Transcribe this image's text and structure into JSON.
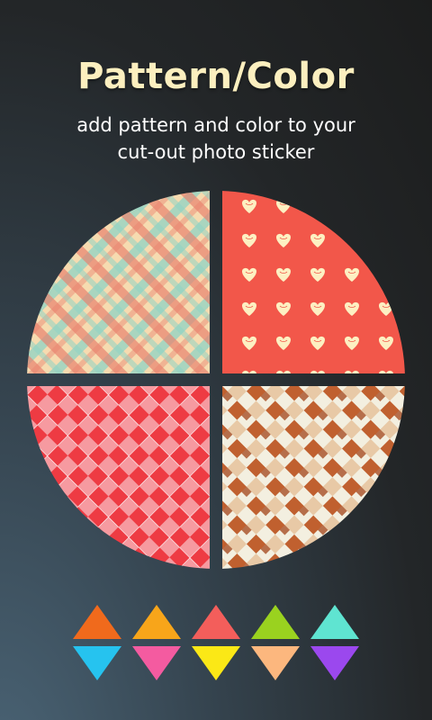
{
  "header": {
    "title": "Pattern/Color",
    "subtitle_line1": "add pattern and color to your",
    "subtitle_line2": "cut-out photo sticker"
  },
  "patterns": [
    {
      "name": "plaid-pattern",
      "colors": [
        "#f7d9a8",
        "#8fd3c4",
        "#e9836f"
      ]
    },
    {
      "name": "hearts-pattern",
      "colors": [
        "#f2574a",
        "#fdf0c2"
      ]
    },
    {
      "name": "argyle-pattern",
      "colors": [
        "#ee3b43",
        "#f69aa0",
        "#ffffff"
      ]
    },
    {
      "name": "zigzag-pattern",
      "colors": [
        "#f3efe0",
        "#c0602f",
        "#e8c9a6"
      ]
    }
  ],
  "swatches": {
    "top": [
      "#f06a1c",
      "#f8a51a",
      "#f35e5b",
      "#9ad21f",
      "#5fe4d1"
    ],
    "bottom": [
      "#26c3ef",
      "#f45ba0",
      "#fbe816",
      "#fcb77e",
      "#9b48ee"
    ]
  }
}
